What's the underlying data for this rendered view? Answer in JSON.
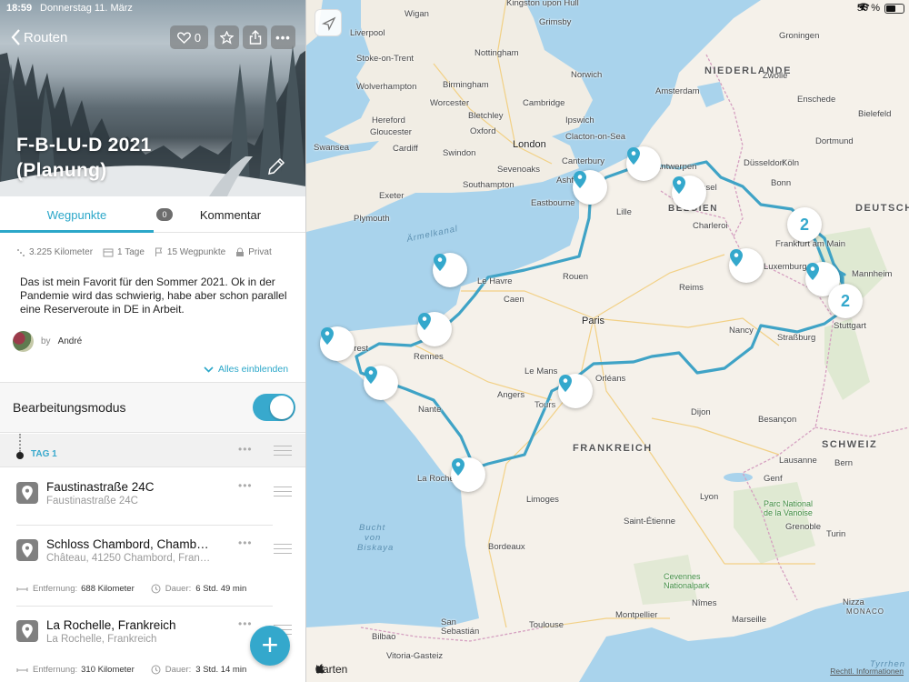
{
  "status_bar": {
    "time": "18:59",
    "date": "Donnerstag 11. März",
    "battery": "50 %"
  },
  "header": {
    "back_label": "Routen",
    "like_count": "0",
    "title_line1": "F-B-LU-D 2021",
    "title_line2": "(Planung)"
  },
  "tabs": {
    "waypoints": "Wegpunkte",
    "comments_count": "0",
    "comments": "Kommentar"
  },
  "meta": {
    "distance": "3.225 Kilometer",
    "days": "1 Tage",
    "waypoints": "15 Wegpunkte",
    "visibility": "Privat"
  },
  "description": "Das ist mein Favorit für den Sommer 2021. Ok in der Pandemie wird das schwierig, habe aber schon parallel eine Reserveroute in DE in Arbeit.",
  "author": {
    "by": "by",
    "name": "André"
  },
  "show_all": "Alles einblenden",
  "edit_mode": {
    "label": "Bearbeitungsmodus",
    "enabled": true
  },
  "day": {
    "label": "TAG 1"
  },
  "waypoints": [
    {
      "title": "Faustinastraße 24C",
      "subtitle": "Faustinastraße 24C"
    },
    {
      "title": "Schloss Chambord, Chamb…",
      "subtitle": "Château, 41250 Chambord, Fran…",
      "distance_label": "Entfernung:",
      "distance": "688 Kilometer",
      "duration_label": "Dauer:",
      "duration": "6 Std. 49 min"
    },
    {
      "title": "La Rochelle, Frankreich",
      "subtitle": "La Rochelle, Frankreich",
      "distance_label": "Entfernung:",
      "distance": "310 Kilometer",
      "duration_label": "Dauer:",
      "duration": "3 Std. 14 min"
    }
  ],
  "colors": {
    "accent": "#34a8cc",
    "route": "#3fa3c6",
    "sea": "#a9d3ec",
    "land": "#f5f1ea"
  },
  "map": {
    "brand": "Karten",
    "legal": "Rechtl. Informationen",
    "clusters": [
      "2",
      "2"
    ],
    "labels": {
      "wigan": "Wigan",
      "kingston": "Kingston upon Hull",
      "liverpool": "Liverpool",
      "grimsby": "Grimsby",
      "stoke": "Stoke-on-Trent",
      "nottingham": "Nottingham",
      "norwich": "Norwich",
      "wolverhampton": "Wolverhampton",
      "birmingham": "Birmingham",
      "worcester": "Worcester",
      "cambridge": "Cambridge",
      "hereford": "Hereford",
      "bletchley": "Bletchley",
      "ipswich": "Ipswich",
      "gloucester": "Gloucester",
      "oxford": "Oxford",
      "clacton": "Clacton-on-Sea",
      "swansea": "Swansea",
      "cardiff": "Cardiff",
      "london": "London",
      "swindon": "Swindon",
      "sevenoaks": "Sevenoaks",
      "canterbury": "Canterbury",
      "ashford": "Ashfo",
      "exeter": "Exeter",
      "southampton": "Southampton",
      "eastbourne": "Eastbourne",
      "plymouth": "Plymouth",
      "aermelkanal": "Ärmelkanal",
      "niederlande": "NIEDERLANDE",
      "amsterdam": "Amsterdam",
      "groningen": "Groningen",
      "zwolle": "Zwolle",
      "enschede": "Enschede",
      "bielefeld": "Bielefeld",
      "dortmund": "Dortmund",
      "duesseldorf": "Düsseldorf",
      "koeln": "Köln",
      "bonn": "Bonn",
      "deutschland": "DEUTSCH",
      "belgien": "BELGIEN",
      "antwerpen": "Antwerpen",
      "bruessel": "Brüssel",
      "lille": "Lille",
      "charleroi": "Charleroi",
      "frankfurt": "Frankfurt am Main",
      "luxemburg": "Luxemburg",
      "mannheim": "Mannheim",
      "stuttgart": "Stuttgart",
      "strassburg": "Straßburg",
      "nancy": "Nancy",
      "reims": "Reims",
      "paris": "Paris",
      "rouen": "Rouen",
      "caen": "Caen",
      "lehavre": "Le Havre",
      "rennes": "Rennes",
      "brest": "Brest",
      "lemans": "Le Mans",
      "orleans": "Orléans",
      "angers": "Angers",
      "tours": "Tours",
      "nantes": "Nante",
      "dijon": "Dijon",
      "besancon": "Besançon",
      "frankreich": "FRANKREICH",
      "schweiz": "SCHWEIZ",
      "bern": "Bern",
      "lausanne": "Lausanne",
      "genf": "Genf",
      "larochelle": "La Rochel",
      "limoges": "Limoges",
      "lyon": "Lyon",
      "saintetienne": "Saint-Étienne",
      "grenoble": "Grenoble",
      "turin": "Turin",
      "bordeaux": "Bordeaux",
      "vanoise1": "Parc National",
      "vanoise2": "de la Vanoise",
      "cevennes1": "Cevennes",
      "cevennes2": "Nationalpark",
      "biskaya1": "Bucht",
      "biskaya2": "von",
      "biskaya3": "Biskaya",
      "nimes": "Nîmes",
      "montpellier": "Montpellier",
      "toulouse": "Toulouse",
      "marseille": "Marseille",
      "nizza": "Nizza",
      "monaco": "MONACO",
      "sansebastian": "San",
      "sebastian": "Sebastián",
      "bilbao": "Bilbao",
      "vitoria": "Vitoria-Gasteiz",
      "tyrrhen": "Tyrrhen"
    }
  }
}
